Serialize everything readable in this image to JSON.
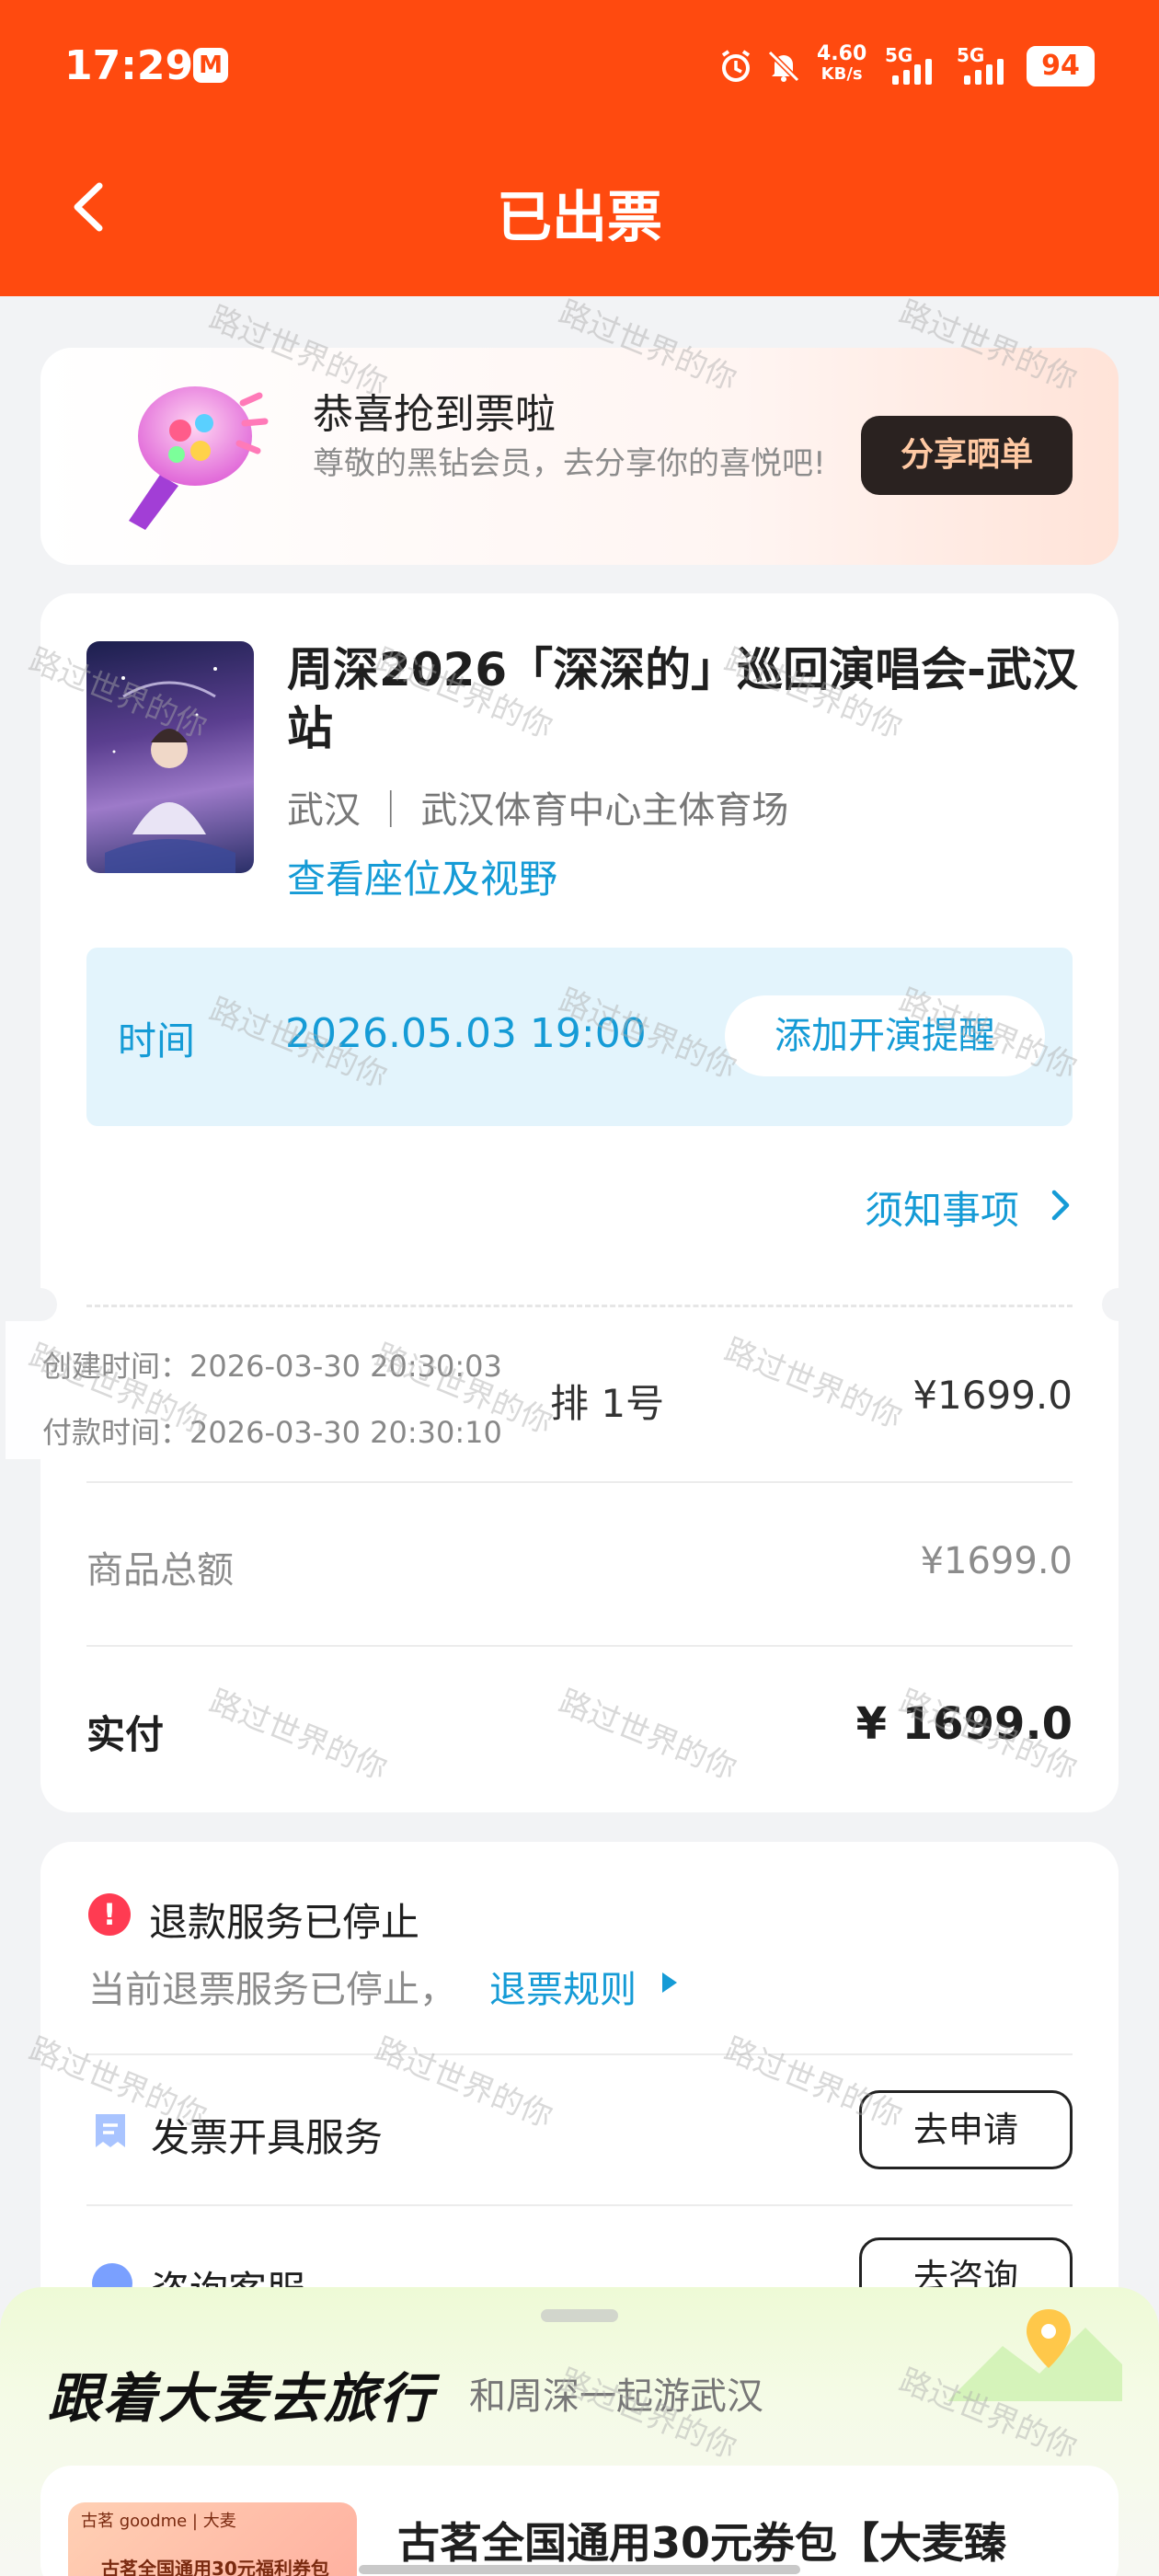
{
  "status_bar": {
    "time": "17:29",
    "app_badge": "M",
    "net_speed_value": "4.60",
    "net_speed_unit": "KB/s",
    "sim1_label": "5G",
    "sim2_label": "5G",
    "battery": "94"
  },
  "header": {
    "title": "已出票"
  },
  "congrats": {
    "title": "恭喜抢到票啦",
    "desc": "尊敬的黑钻会员，去分享你的喜悦吧!",
    "share_button": "分享晒单"
  },
  "order": {
    "title": "周深2026「深深的」巡回演唱会-武汉站",
    "venue": "武汉 ｜ 武汉体育中心主体育场",
    "seat_link": "查看座位及视野",
    "time_label": "时间",
    "time_value": "2026.05.03 19:00",
    "remind_button": "添加开演提醒",
    "notice_link": "须知事项",
    "created_time": "创建时间：2026-03-30 20:30:03",
    "paid_time": "付款时间：2026-03-30 20:30:10",
    "seat": "排 1号",
    "seat_price": "¥1699.0",
    "subtotal_label": "商品总额",
    "subtotal_value": "¥1699.0",
    "paid_label": "实付",
    "paid_value": "¥ 1699.0"
  },
  "services": {
    "refund_title": "退款服务已停止",
    "refund_desc": "当前退票服务已停止，",
    "refund_link": "退票规则",
    "invoice_label": "发票开具服务",
    "invoice_button": "去申请",
    "consult_label": "咨询客服",
    "consult_button": "去咨询"
  },
  "travel": {
    "title": "跟着大麦去旅行",
    "subtitle": "和周深一起游武汉",
    "product_brand": "古茗 goodme | 大麦",
    "product_thumb_text": "古茗全国通用30元福利券包",
    "product_title": "古茗全国通用30元券包【大麦臻"
  },
  "watermark": "路过世界的你",
  "colors": {
    "header": "#ff4a0f",
    "link": "#159bd6",
    "time_box": "#e3f4fc",
    "warning": "#ff3b52"
  }
}
